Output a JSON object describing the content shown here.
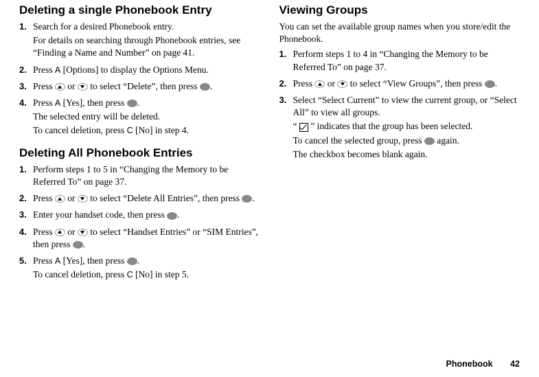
{
  "left": {
    "heading1": "Deleting a single Phonebook Entry",
    "s1": {
      "n": "1.",
      "text": "Search for a desired Phonebook entry.",
      "sub": "For details on searching through Phonebook entries, see “Finding a Name and Number” on page 41."
    },
    "s2": {
      "n": "2.",
      "pre": "Press ",
      "key": "A",
      "post": " [Options] to display the Options Menu."
    },
    "s3": {
      "n": "3.",
      "a": "Press ",
      "b": " or ",
      "c": " to select “Delete”, then press ",
      "d": "."
    },
    "s4": {
      "n": "4.",
      "pre": "Press ",
      "key": "A",
      "mid": " [Yes], then press ",
      "end": ".",
      "sub1": "The selected entry will be deleted.",
      "sub2a": "To cancel deletion, press ",
      "sub2key": "C",
      "sub2b": " [No] in step 4."
    },
    "heading2": "Deleting All Phonebook Entries",
    "t1": {
      "n": "1.",
      "text": "Perform steps 1 to 5 in “Changing the Memory to be Referred To” on page 37."
    },
    "t2": {
      "n": "2.",
      "a": "Press ",
      "b": " or ",
      "c": " to select “Delete All Entries”, then press ",
      "d": "."
    },
    "t3": {
      "n": "3.",
      "a": "Enter your handset code, then press ",
      "b": "."
    },
    "t4": {
      "n": "4.",
      "a": "Press ",
      "b": " or ",
      "c": " to select “Handset Entries” or “SIM Entries”, then press ",
      "d": "."
    },
    "t5": {
      "n": "5.",
      "pre": "Press ",
      "key": "A",
      "mid": " [Yes], then press ",
      "end": ".",
      "suba": "To cancel deletion, press ",
      "subkey": "C",
      "subb": " [No] in step 5."
    }
  },
  "right": {
    "heading": "Viewing Groups",
    "intro": "You can set the available group names when you store/edit the Phonebook.",
    "s1": {
      "n": "1.",
      "text": "Perform steps 1 to 4 in “Changing the Memory to be Referred To” on page 37."
    },
    "s2": {
      "n": "2.",
      "a": "Press ",
      "b": " or ",
      "c": " to select “View Groups”, then press ",
      "d": "."
    },
    "s3": {
      "n": "3.",
      "text": "Select “Select Current” to view the current group, or “Select All” to view all groups.",
      "sub1a": "“",
      "sub1b": "” indicates that the group has been selected.",
      "sub2a": "To cancel the selected group, press ",
      "sub2b": " again.",
      "sub3": "The checkbox becomes blank again."
    }
  },
  "footer": {
    "section": "Phonebook",
    "page": "42"
  }
}
